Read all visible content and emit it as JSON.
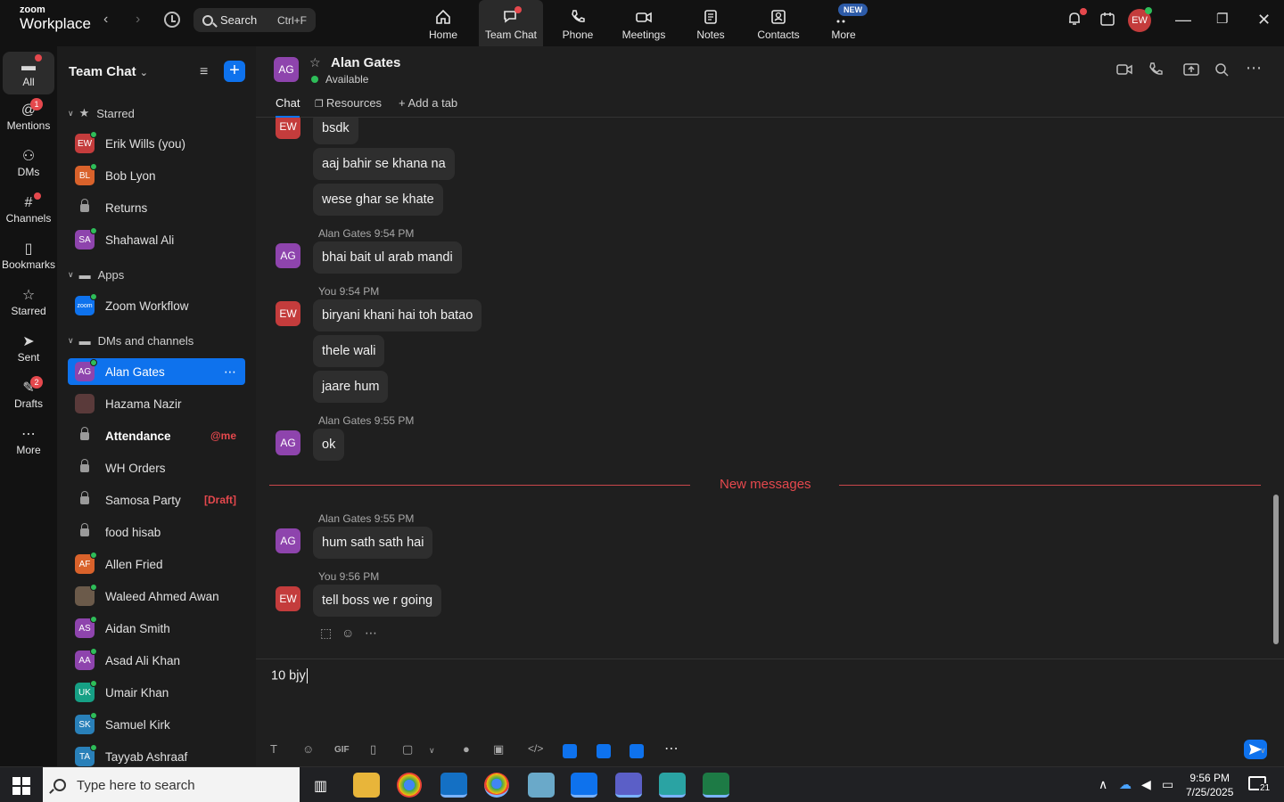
{
  "app": {
    "logo_top": "zoom",
    "logo_bottom": "Workplace",
    "search_label": "Search",
    "search_shortcut": "Ctrl+F",
    "nav": [
      {
        "label": "Home",
        "icon": "home-icon"
      },
      {
        "label": "Team Chat",
        "icon": "team-chat-icon"
      },
      {
        "label": "Phone",
        "icon": "phone-icon"
      },
      {
        "label": "Meetings",
        "icon": "meetings-icon"
      },
      {
        "label": "Notes",
        "icon": "notes-icon"
      },
      {
        "label": "Contacts",
        "icon": "contacts-icon"
      },
      {
        "label": "More",
        "icon": "more-icon"
      }
    ],
    "new_badge": "NEW",
    "user_initials": "EW"
  },
  "rail": [
    {
      "label": "All",
      "icon": "chat-bubble-icon"
    },
    {
      "label": "Mentions",
      "icon": "at-icon",
      "badge": "1"
    },
    {
      "label": "DMs",
      "icon": "people-icon"
    },
    {
      "label": "Channels",
      "icon": "hash-icon"
    },
    {
      "label": "Bookmarks",
      "icon": "bookmark-icon"
    },
    {
      "label": "Starred",
      "icon": "star-icon"
    },
    {
      "label": "Sent",
      "icon": "send-icon"
    },
    {
      "label": "Drafts",
      "icon": "draft-icon",
      "badge": "2"
    },
    {
      "label": "More",
      "icon": "more-dots-icon"
    }
  ],
  "sidebar": {
    "title": "Team Chat",
    "sections": {
      "starred": "Starred",
      "apps": "Apps",
      "dms": "DMs and channels"
    },
    "starred": [
      {
        "name": "Erik Wills (you)",
        "initials": "EW",
        "color": "#c43c3c"
      },
      {
        "name": "Bob Lyon",
        "initials": "BL",
        "color": "#d9622b"
      },
      {
        "name": "Returns"
      },
      {
        "name": "Shahawal Ali",
        "initials": "SA",
        "color": "#8e44ad"
      }
    ],
    "apps": [
      {
        "name": "Zoom Workflow",
        "initials": "zoom",
        "color": "#0e72ed"
      }
    ],
    "dms": [
      {
        "name": "Alan Gates",
        "initials": "AG",
        "color": "#8e44ad"
      },
      {
        "name": "Hazama Nazir",
        "initials": "",
        "color": "#5a3a3a"
      },
      {
        "name": "Attendance",
        "tag": "@me"
      },
      {
        "name": "WH Orders"
      },
      {
        "name": "Samosa Party",
        "tag": "[Draft]"
      },
      {
        "name": "food hisab"
      },
      {
        "name": "Allen Fried",
        "initials": "AF",
        "color": "#d9622b"
      },
      {
        "name": "Waleed Ahmed Awan",
        "initials": "",
        "color": "#6b5a4a"
      },
      {
        "name": "Aidan Smith",
        "initials": "AS",
        "color": "#8e44ad"
      },
      {
        "name": "Asad Ali Khan",
        "initials": "AA",
        "color": "#8e44ad"
      },
      {
        "name": "Umair Khan",
        "initials": "UK",
        "color": "#16a085"
      },
      {
        "name": "Samuel Kirk",
        "initials": "SK",
        "color": "#2980b9"
      },
      {
        "name": "Tayyab Ashraaf",
        "initials": "TA",
        "color": "#2980b9"
      }
    ]
  },
  "chat": {
    "contact_name": "Alan Gates",
    "contact_initials": "AG",
    "status": "Available",
    "tabs": [
      "Chat",
      "Resources",
      "Add a tab"
    ],
    "messages": [
      {
        "who": "EW",
        "meta": "",
        "texts": [
          "bsdk",
          "aaj bahir se khana na",
          "wese ghar se khate"
        ]
      },
      {
        "who": "AG",
        "meta": "Alan Gates 9:54 PM",
        "texts": [
          "bhai bait ul arab mandi"
        ]
      },
      {
        "who": "EW",
        "meta": "You 9:54 PM",
        "texts": [
          "biryani khani hai toh batao",
          "thele wali",
          "jaare hum"
        ]
      },
      {
        "who": "AG",
        "meta": "Alan Gates 9:55 PM",
        "texts": [
          "ok"
        ]
      },
      {
        "who": "AG",
        "meta": "Alan Gates 9:55 PM",
        "texts": [
          "hum sath sath hai"
        ]
      },
      {
        "who": "EW",
        "meta": "You 9:56 PM",
        "texts": [
          "tell boss we r going"
        ]
      }
    ],
    "new_messages_label": "New messages",
    "composer_value": "10 bjy"
  },
  "taskbar": {
    "search_placeholder": "Type here to search",
    "time": "9:56 PM",
    "date": "7/25/2025",
    "notification_count": "21"
  }
}
